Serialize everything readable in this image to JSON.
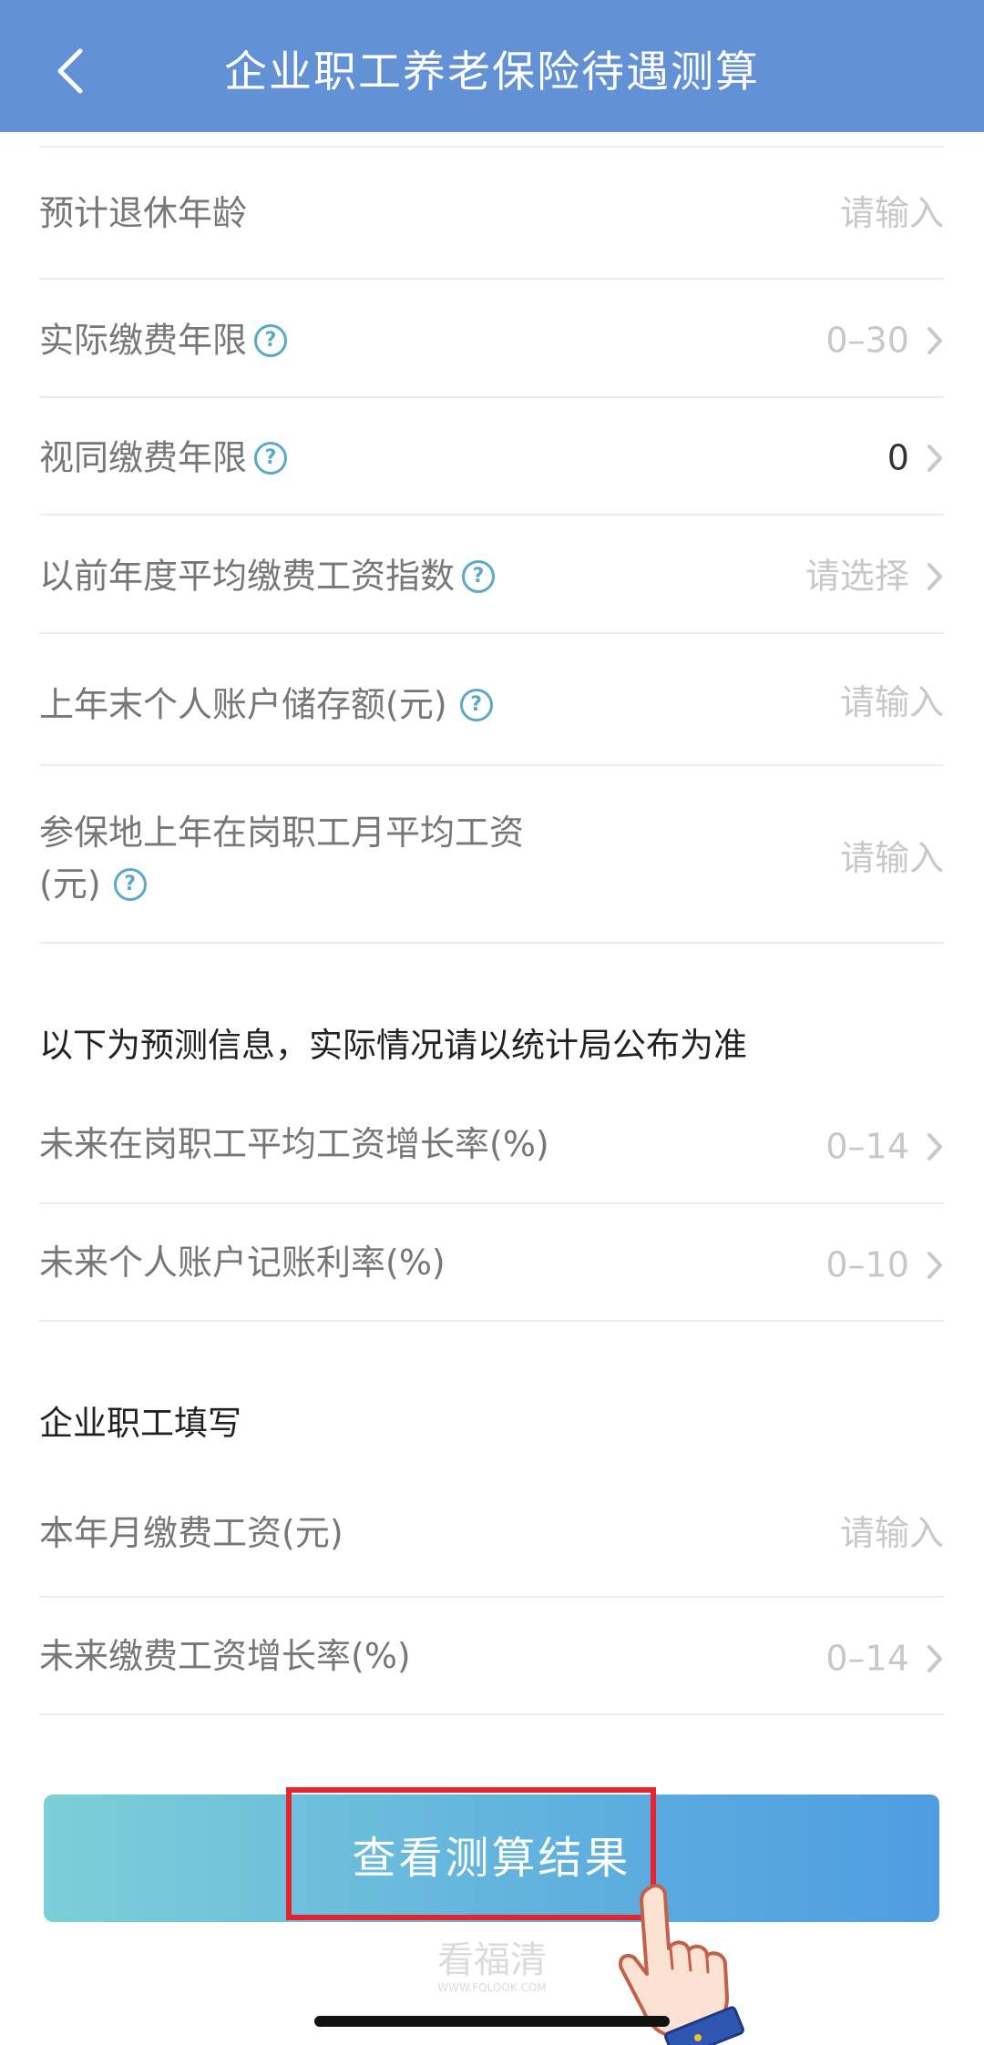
{
  "header": {
    "title": "企业职工养老保险待遇测算"
  },
  "rows": [
    {
      "label": "预计退休年龄",
      "value": "请输入"
    },
    {
      "label": "实际缴费年限",
      "value": "0–30"
    },
    {
      "label": "视同缴费年限",
      "value": "0"
    },
    {
      "label": "以前年度平均缴费工资指数",
      "value": "请选择"
    },
    {
      "label": "上年末个人账户储存额(元)",
      "value": "请输入"
    },
    {
      "label_line1": "参保地上年在岗职工月平均工资",
      "label_line2": "(元)",
      "value": "请输入"
    }
  ],
  "forecast": {
    "title": "以下为预测信息，实际情况请以统计局公布为准",
    "rows": [
      {
        "label": "未来在岗职工平均工资增长率(%)",
        "value": "0–14"
      },
      {
        "label": "未来个人账户记账利率(%)",
        "value": "0–10"
      }
    ]
  },
  "employee": {
    "title": "企业职工填写",
    "rows": [
      {
        "label": "本年月缴费工资(元)",
        "value": "请输入"
      },
      {
        "label": "未来缴费工资增长率(%)",
        "value": "0–14"
      }
    ]
  },
  "submit": {
    "label": "查看测算结果"
  },
  "watermark": {
    "line1": "看福清",
    "line2": "WWW.FQLOOK.COM"
  },
  "colors": {
    "header": "#6391d6",
    "help_icon": "#5aa9cc",
    "highlight": "#e3252e",
    "placeholder": "#c8c8c8"
  }
}
